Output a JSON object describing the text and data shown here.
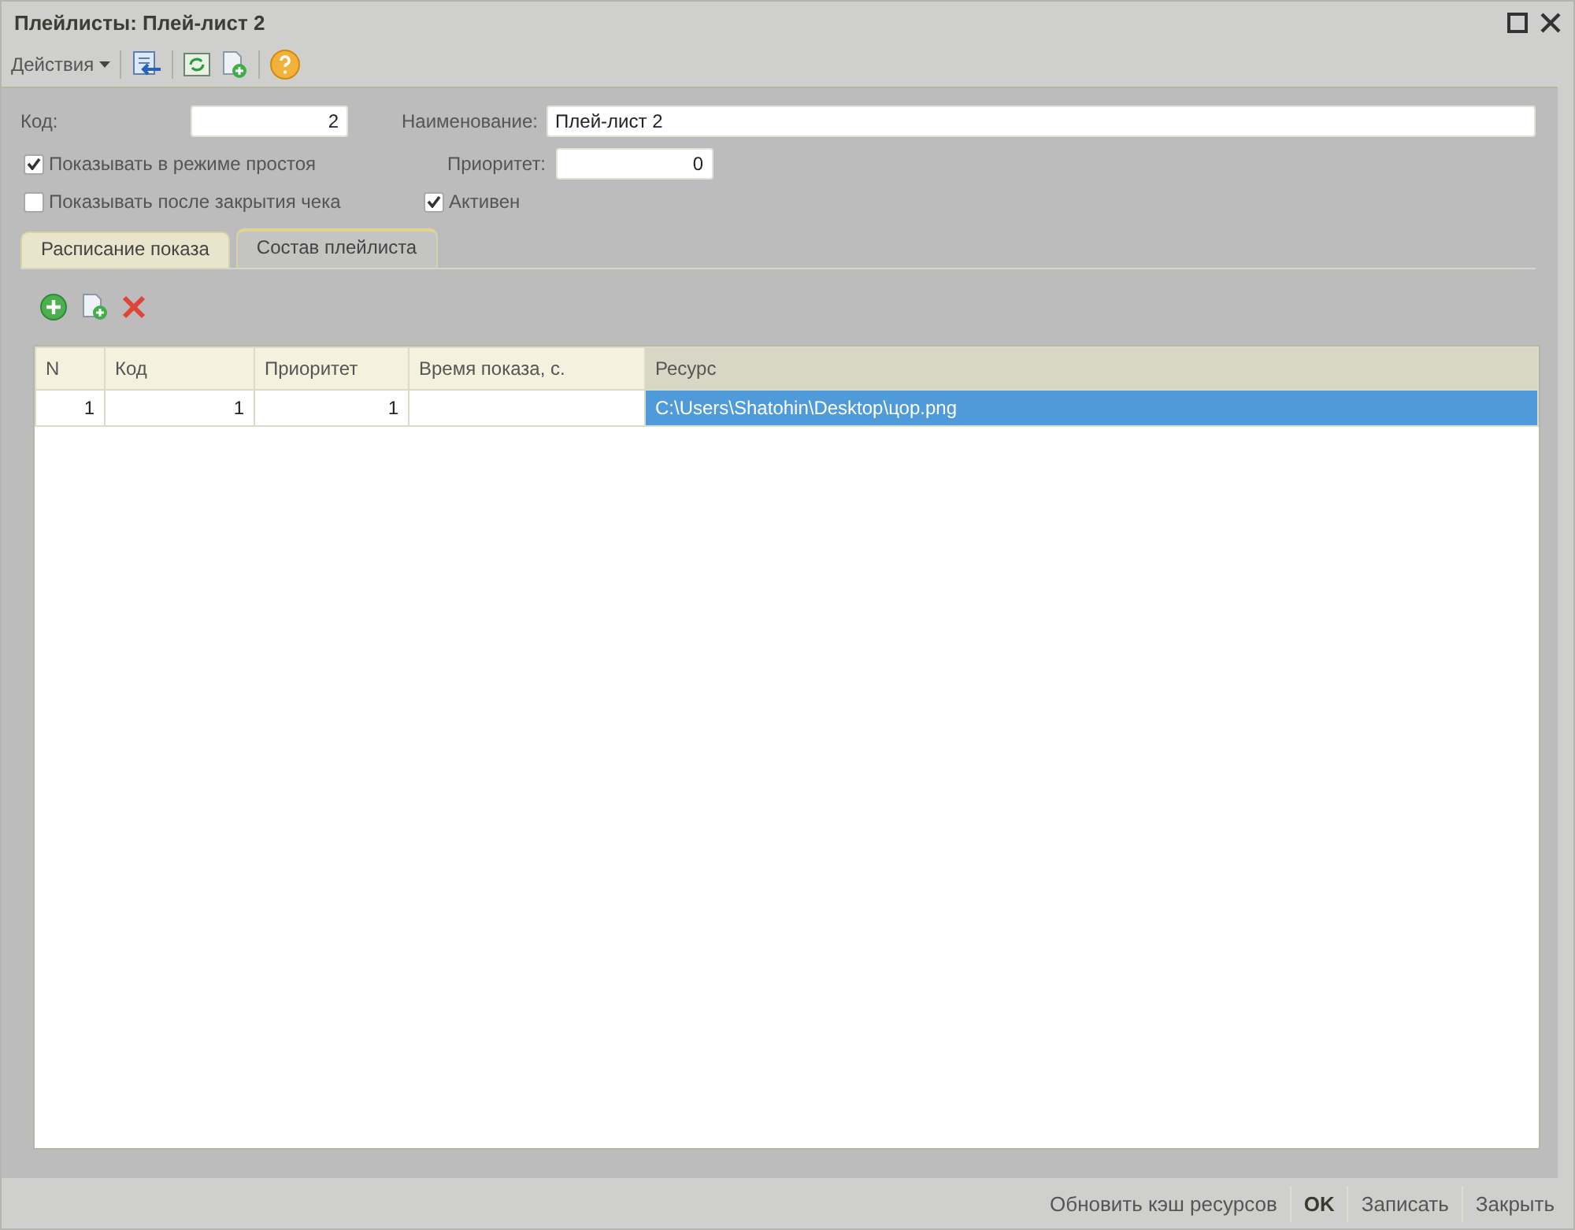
{
  "window": {
    "title": "Плейлисты: Плей-лист 2"
  },
  "toolbar": {
    "actions_menu": "Действия"
  },
  "form": {
    "code": {
      "label": "Код:",
      "value": "2"
    },
    "name": {
      "label": "Наименование:",
      "value": "Плей-лист 2"
    },
    "priority": {
      "label": "Приоритет:",
      "value": "0"
    },
    "checkboxes": [
      {
        "label": "Показывать в режиме простоя",
        "checked": true
      },
      {
        "label": "Показывать после закрытия чека",
        "checked": false
      },
      {
        "label": "Активен",
        "checked": true
      }
    ]
  },
  "tabs": [
    {
      "label": "Расписание показа",
      "selected": false
    },
    {
      "label": "Состав плейлиста",
      "selected": true
    }
  ],
  "table": {
    "columns": [
      {
        "label": "N",
        "selected": false
      },
      {
        "label": "Код",
        "selected": false
      },
      {
        "label": "Приоритет",
        "selected": false
      },
      {
        "label": "Время показа, с.",
        "selected": false
      },
      {
        "label": "Ресурс",
        "selected": true
      }
    ],
    "rows": [
      {
        "selected": true,
        "cells": {
          "n": "1",
          "code": "1",
          "priority": "1",
          "resource": "C:\\Users\\Shatohin\\Desktop\\цор.png"
        }
      }
    ]
  },
  "buttons": [
    {
      "label": "Обновить кэш ресурсов",
      "default": false
    },
    {
      "label": "OK",
      "default": true
    },
    {
      "label": "Записать",
      "default": false
    },
    {
      "label": "Закрыть",
      "default": false
    }
  ]
}
